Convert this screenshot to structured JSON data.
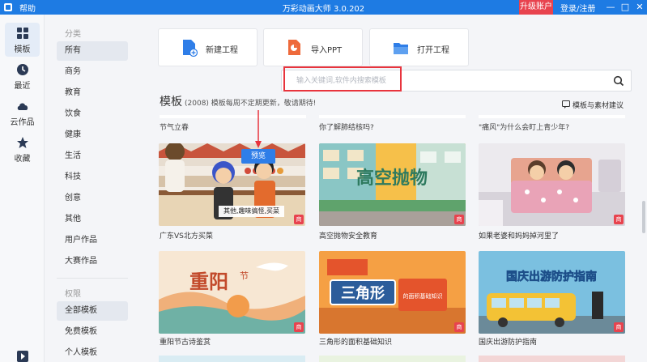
{
  "titlebar": {
    "help": "帮助",
    "title": "万彩动画大师 3.0.202",
    "upgrade": "升级账户",
    "login": "登录/注册",
    "controls": [
      "—",
      "□",
      "✕"
    ]
  },
  "leftnav": {
    "items": [
      {
        "label": "模板",
        "icon": "grid-icon",
        "active": true
      },
      {
        "label": "最近",
        "icon": "clock-icon",
        "active": false
      },
      {
        "label": "云作品",
        "icon": "cloud-icon",
        "active": false
      },
      {
        "label": "收藏",
        "icon": "star-icon",
        "active": false
      }
    ],
    "bottom_icon": "play-icon"
  },
  "categories": {
    "group1_title": "分类",
    "group1": [
      "所有",
      "商务",
      "教育",
      "饮食",
      "健康",
      "生活",
      "科技",
      "创意",
      "其他",
      "用户作品",
      "大赛作品"
    ],
    "group2_title": "权限",
    "group2": [
      "全部模板",
      "免费模板",
      "个人模板"
    ],
    "active": "所有"
  },
  "actions": [
    {
      "label": "新建工程",
      "icon": "new-project-icon"
    },
    {
      "label": "导入PPT",
      "icon": "import-ppt-icon"
    },
    {
      "label": "打开工程",
      "icon": "open-folder-icon"
    }
  ],
  "search": {
    "placeholder": "输入关键词,软件内搜索模板"
  },
  "section": {
    "title": "模板",
    "subtitle": "(2008) 模板每周不定期更新，敬请期待!",
    "suggest": "模板与素材建议"
  },
  "prev_row_captions": [
    "节气立春",
    "你了解肺结核吗?",
    "\"痛风\"为什么会盯上青少年?"
  ],
  "templates_row1": [
    {
      "caption": "广东VS北方买菜",
      "overlay": "其他,趣味搞怪,买菜",
      "preview": "预览",
      "badge": "商"
    },
    {
      "caption": "高空抛物安全教育",
      "art_text": "高空抛物",
      "badge": "商"
    },
    {
      "caption": "如果老婆和妈妈掉河里了",
      "badge": "商"
    }
  ],
  "templates_row2": [
    {
      "caption": "重阳节古诗鉴赏",
      "art_text": "重阳",
      "art_sub": "节",
      "badge": "商"
    },
    {
      "caption": "三角形的面积基础知识",
      "art_text": "三角形",
      "art_sub": "的面积基础知识",
      "badge": "商"
    },
    {
      "caption": "国庆出游防护指南",
      "art_text": "国庆出游防护指南",
      "badge": "商"
    }
  ],
  "colors": {
    "accent": "#1e7be3",
    "upgrade": "#e8434e",
    "highlight": "#e8343d"
  }
}
